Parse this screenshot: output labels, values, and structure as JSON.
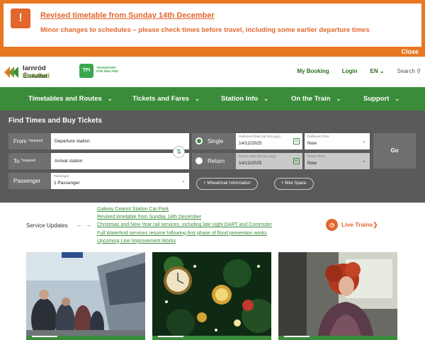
{
  "alert": {
    "icon": "!",
    "title": "Revised timetable from Sunday 14th December",
    "text": "Minor changes to schedules – please check times before travel, including some earlier departure times",
    "close": "Close"
  },
  "header": {
    "logo_line1": "Iarnród Éireann",
    "logo_line2": "Irish Rail",
    "tfi_badge": "TFI",
    "tfi_text": "TRANSPORT FOR IRELAND",
    "links": [
      "My Booking",
      "Login",
      "EN"
    ],
    "search": "Search"
  },
  "nav": {
    "items": [
      "Timetables and Routes",
      "Tickets and Fares",
      "Station Info",
      "On the Train",
      "Support"
    ]
  },
  "search_panel": {
    "title": "Find Times and Buy Tickets",
    "from_label": "From",
    "from_required": "*required",
    "from_placeholder": "Departure station",
    "to_label": "To",
    "to_required": "*required",
    "to_placeholder": "Arrival station",
    "single": "Single",
    "return": "Return",
    "outbound_date_label": "Outbound Date (dd.mm.yyyy)",
    "outbound_date": "14/12/2025",
    "return_date_label": "Return Date (dd.mm.yyyy)",
    "return_date": "14/12/2025",
    "outbound_time_label": "Outbound Time",
    "outbound_time": "Now",
    "return_time_label": "Return Time",
    "return_time": "Now",
    "go": "Go",
    "passenger_label": "Passenger",
    "passenger_small": "Passenger",
    "passenger_value": "1 Passenger",
    "wheelchair": "+ Wheelchair Information",
    "bike": "+ Bike Space"
  },
  "service": {
    "label": "Service Updates",
    "updates": [
      "Galway Ceannt Station Car Park",
      "Revised timetable from Sunday 14th December",
      "Christmas and New Year rail services, including late night DART and Commuter",
      "Full Waterford services resume following first phase of flood prevention works",
      "Upcoming Line Improvement Works"
    ],
    "live_trains": "Live Trains"
  },
  "colors": {
    "green": "#3b8c3a",
    "orange": "#e2662e",
    "panel": "#5a5a5a"
  }
}
